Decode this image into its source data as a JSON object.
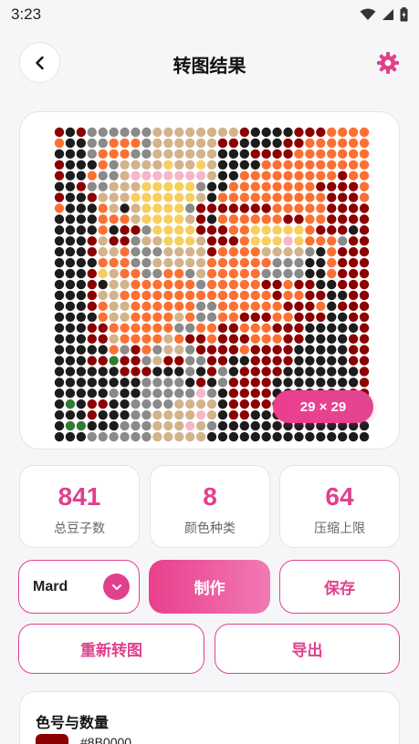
{
  "status_bar": {
    "time": "3:23"
  },
  "header": {
    "title": "转图结果"
  },
  "preview": {
    "badge": "29 × 29",
    "cols": 29,
    "rows": 29,
    "palette": {
      "R": "#8b0000",
      "B": "#1c1c1c",
      "G": "#8a8a8a",
      "O": "#fb7134",
      "T": "#d2b48c",
      "Y": "#f7cf5e",
      "P": "#f5b7c9",
      "N": "#2e7d32"
    },
    "pattern": [
      "RBRGGGGGGTTTTTTTTRBBBBRRROOOO",
      "OBBGGOOOGTTTTTTRRBBBBRROOOOOO",
      "BBBGOOOGGTTTTTTBBBRRRROOOOOOO",
      "RBBBOGTTTTYTTYTBBBBOOOOOOOOOO",
      "RBBOGGTPPPPPPPTBBOOOOOOOOOROO",
      "BBRGGTTTYYYYYGBBOOOOOOOORRRRO",
      "RBBRTTTYYYYYYTBOOOOOOOOOORRRO",
      "OBBBOTBTYYYYGRRRRRRROOOOORRRR",
      "BBBBOOOTYYYYTRBOOOOOORROORRRR",
      "BBBBOBRRGYYYYRRROOYYYYYORRRBR",
      "BBBRTRRGTTYYYTRRROYYYPYOOOGRR",
      "BBBRTTOGGGTTTTROOOOTTTTGBORRR",
      "BBBBOOOGGTTTTTOOOOOOGGGBBORRR",
      "BBBRYTOOGGOOGTOOOOOGGGGBBORRR",
      "BBBRBTTOOOOOOGOOOOORRORRBBRRR",
      "BBBRTTOOOOOOOOOOOOOOROORRBBRR",
      "BBBROTTOOOOOOGGOOOOOORRROBRRR",
      "BBBBOTTOOOOTOGGOORRROORRRBBRR",
      "BBBRROOOOOOGGOORROOORRRBBBBBR",
      "BBBRRTOOOOTORRORRROOORRBBBBRR",
      "BBBBBOGROGTTGRRRRORRRRBBBBBRR",
      "BBBRRNRRGTRRGGRRBBRRRRBBBBBRR",
      "BBBBBBRRRBBBGBRGBRRRRBBBBBBBR",
      "BBBBBBBBGGGGBRBGRRRRBBBBBBBBR",
      "BBBBBGBBGGGGGPGBRRRRBBBBBBBRR",
      "BNBRRBBGGGGTTTTBRRRRBBBBBBBBR",
      "BBBRBBBGGTTTTPTBRRBBBBBBBBBBB",
      "BNNBBBGGGTTTPTGBBBBBBBBBBBBBB",
      "BBBGGGGGGTTTTTBBBBBBBBBBBBBBB"
    ]
  },
  "stats": {
    "total_beads": "841",
    "total_beads_label": "总豆子数",
    "color_count": "8",
    "color_count_label": "颜色种类",
    "limit": "64",
    "limit_label": "压缩上限"
  },
  "controls": {
    "brand_selected": "Mard",
    "make_label": "制作",
    "save_label": "保存",
    "reconvert_label": "重新转图",
    "export_label": "导出"
  },
  "color_list": {
    "title": "色号与数量",
    "first_code": "#8B0000",
    "first_color": "#8b0000"
  },
  "colors": {
    "accent": "#e0418d",
    "background": "#f6f6f8"
  }
}
